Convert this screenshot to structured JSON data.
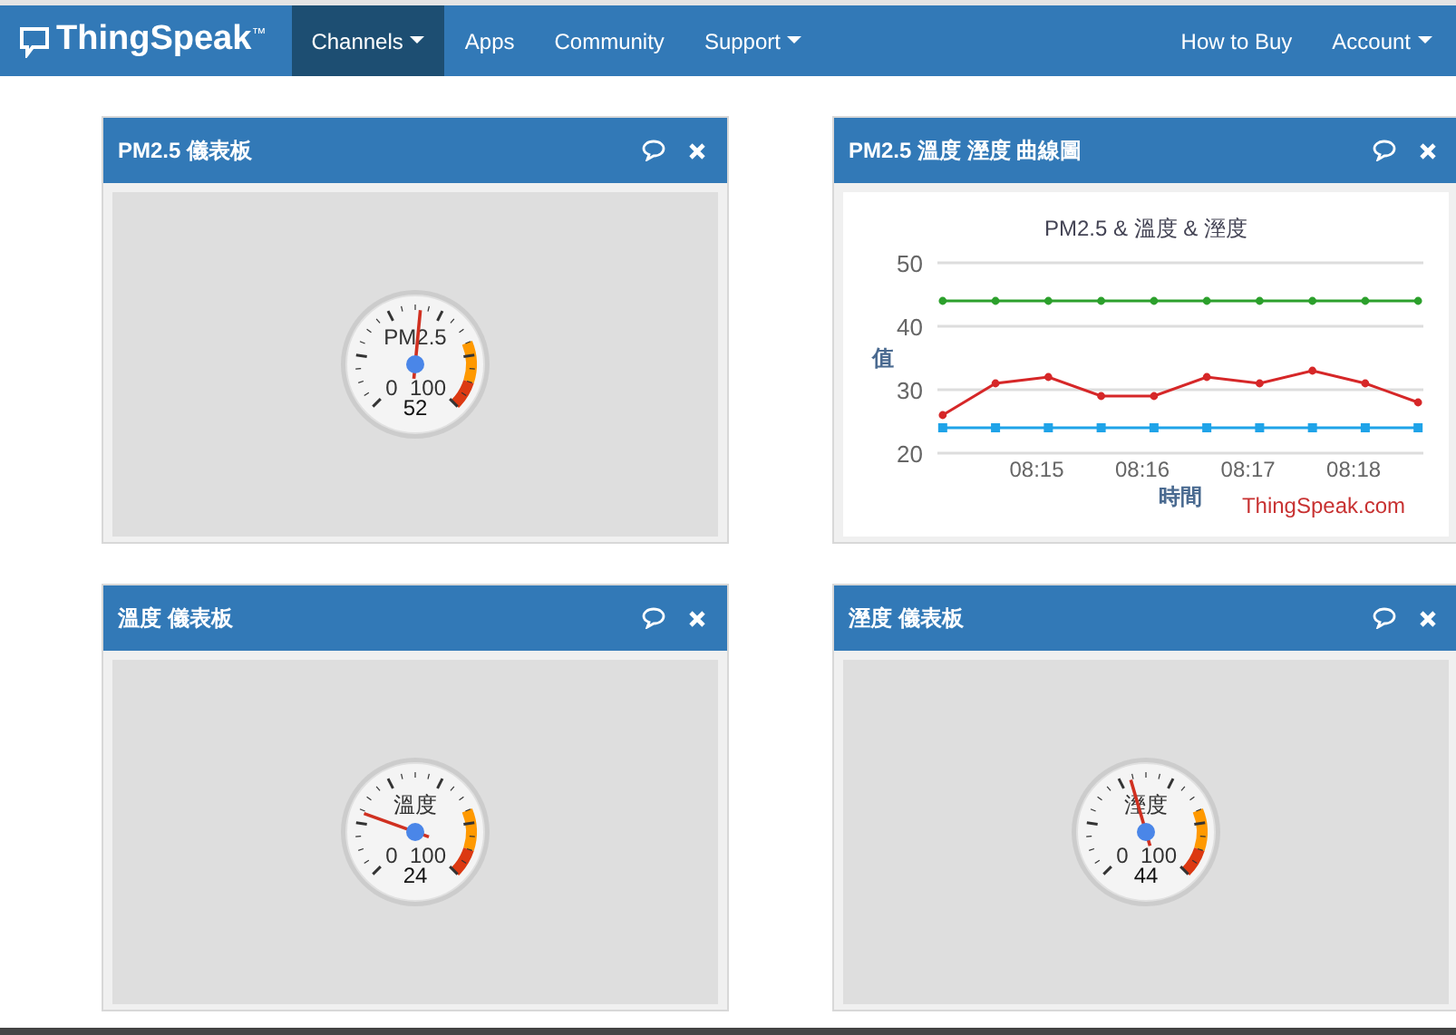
{
  "navbar": {
    "brand": "ThingSpeak",
    "trademark": "™",
    "items": [
      {
        "label": "Channels",
        "dropdown": true,
        "selected": true
      },
      {
        "label": "Apps",
        "dropdown": false,
        "selected": false
      },
      {
        "label": "Community",
        "dropdown": false,
        "selected": false
      },
      {
        "label": "Support",
        "dropdown": true,
        "selected": false
      }
    ],
    "right_items": [
      {
        "label": "How to Buy",
        "dropdown": false
      },
      {
        "label": "Account",
        "dropdown": true
      }
    ]
  },
  "widgets": [
    {
      "kind": "gauge",
      "title": "PM2.5 儀表板",
      "gauge": {
        "label": "PM2.5",
        "min": "0",
        "max": "100",
        "value": "52",
        "level": 0.52
      }
    },
    {
      "kind": "chart",
      "title": "PM2.5 溫度 溼度 曲線圖",
      "credit": "ThingSpeak.com",
      "chart_data": {
        "type": "line",
        "title": "PM2.5 & 溫度 & 溼度",
        "xlabel": "時間",
        "ylabel": "值",
        "categories": [
          null,
          null,
          "08:15",
          null,
          "08:16",
          null,
          "08:17",
          null,
          "08:18",
          null
        ],
        "ylim": [
          20,
          50
        ],
        "yticks": [
          20,
          30,
          40,
          50
        ],
        "series": [
          {
            "color": "#2ca02c",
            "marker": "circle",
            "values": [
              44,
              44,
              44,
              44,
              44,
              44,
              44,
              44,
              44,
              44
            ]
          },
          {
            "color": "#d62728",
            "marker": "circle",
            "values": [
              26,
              31,
              32,
              29,
              29,
              32,
              31,
              33,
              31,
              28
            ]
          },
          {
            "color": "#1fa3e8",
            "marker": "square",
            "values": [
              24,
              24,
              24,
              24,
              24,
              24,
              24,
              24,
              24,
              24
            ]
          }
        ]
      }
    },
    {
      "kind": "gauge",
      "title": "溫度 儀表板",
      "gauge": {
        "label": "溫度",
        "min": "0",
        "max": "100",
        "value": "24",
        "level": 0.24
      }
    },
    {
      "kind": "gauge",
      "title": "溼度 儀表板",
      "gauge": {
        "label": "溼度",
        "min": "0",
        "max": "100",
        "value": "44",
        "level": 0.44
      }
    }
  ]
}
